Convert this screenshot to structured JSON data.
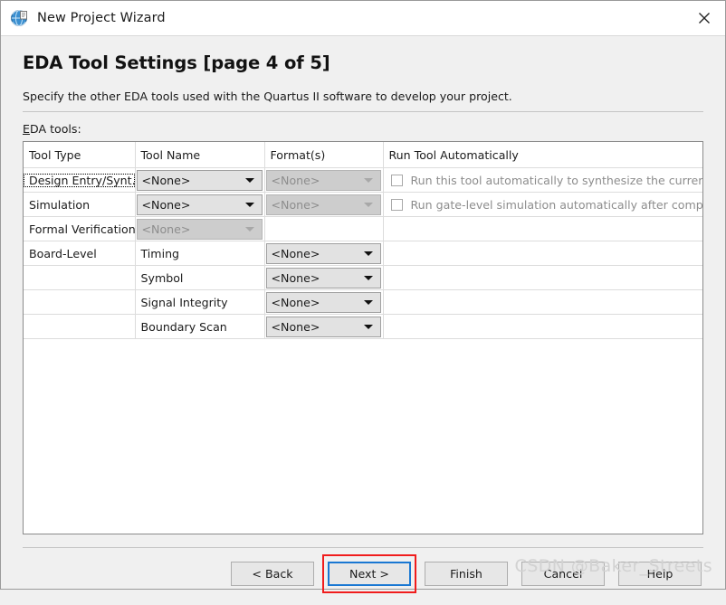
{
  "window": {
    "title": "New Project Wizard",
    "icon": "quartus-globe-icon",
    "close_label": "✕"
  },
  "page": {
    "heading": "EDA Tool Settings [page 4 of 5]",
    "description": "Specify the other EDA tools used with the Quartus II software to develop your project.",
    "field_label": "EDA tools:"
  },
  "table": {
    "headers": [
      "Tool Type",
      "Tool Name",
      "Format(s)",
      "Run Tool Automatically"
    ],
    "rows": [
      {
        "tool_type": "Design Entry/Synt...",
        "tool_type_focused": true,
        "tool_name": {
          "value": "<None>",
          "disabled": false,
          "visible": true
        },
        "format": {
          "value": "<None>",
          "disabled": true,
          "visible": true
        },
        "run": {
          "visible": true,
          "checked": false,
          "label": "Run this tool automatically to synthesize the current design"
        }
      },
      {
        "tool_type": "Simulation",
        "tool_type_focused": false,
        "tool_name": {
          "value": "<None>",
          "disabled": false,
          "visible": true
        },
        "format": {
          "value": "<None>",
          "disabled": true,
          "visible": true
        },
        "run": {
          "visible": true,
          "checked": false,
          "label": "Run gate-level simulation automatically after compilation"
        }
      },
      {
        "tool_type": "Formal Verification",
        "tool_type_focused": false,
        "tool_name": {
          "value": "<None>",
          "disabled": true,
          "visible": true
        },
        "format": {
          "value": "",
          "disabled": true,
          "visible": false
        },
        "run": {
          "visible": false,
          "checked": false,
          "label": ""
        }
      },
      {
        "tool_type": "Board-Level",
        "tool_type_focused": false,
        "tool_name": {
          "value": "Timing",
          "disabled": false,
          "visible": false,
          "plain": true
        },
        "format": {
          "value": "<None>",
          "disabled": false,
          "visible": true
        },
        "run": {
          "visible": false,
          "checked": false,
          "label": ""
        }
      },
      {
        "tool_type": "",
        "tool_type_focused": false,
        "tool_name": {
          "value": "Symbol",
          "disabled": false,
          "visible": false,
          "plain": true
        },
        "format": {
          "value": "<None>",
          "disabled": false,
          "visible": true
        },
        "run": {
          "visible": false,
          "checked": false,
          "label": ""
        }
      },
      {
        "tool_type": "",
        "tool_type_focused": false,
        "tool_name": {
          "value": "Signal Integrity",
          "disabled": false,
          "visible": false,
          "plain": true
        },
        "format": {
          "value": "<None>",
          "disabled": false,
          "visible": true
        },
        "run": {
          "visible": false,
          "checked": false,
          "label": ""
        }
      },
      {
        "tool_type": "",
        "tool_type_focused": false,
        "tool_name": {
          "value": "Boundary Scan",
          "disabled": false,
          "visible": false,
          "plain": true
        },
        "format": {
          "value": "<None>",
          "disabled": false,
          "visible": true
        },
        "run": {
          "visible": false,
          "checked": false,
          "label": ""
        }
      }
    ]
  },
  "footer": {
    "buttons": [
      {
        "label": "< Back",
        "name": "back-button",
        "focused": false,
        "annotated": false
      },
      {
        "label": "Next >",
        "name": "next-button",
        "focused": true,
        "annotated": true
      },
      {
        "label": "Finish",
        "name": "finish-button",
        "focused": false,
        "annotated": false
      },
      {
        "label": "Cancel",
        "name": "cancel-button",
        "focused": false,
        "annotated": false
      },
      {
        "label": "Help",
        "name": "help-button",
        "focused": false,
        "annotated": false
      }
    ]
  },
  "watermark": {
    "text": "CSDN @Baker_Streets"
  },
  "colors": {
    "accent_focus": "#1977d2",
    "annotation": "#f01c1c",
    "dialog_bg": "#f0f0f0",
    "table_bg": "#ffffff",
    "disabled_text": "#8d8d8d"
  }
}
